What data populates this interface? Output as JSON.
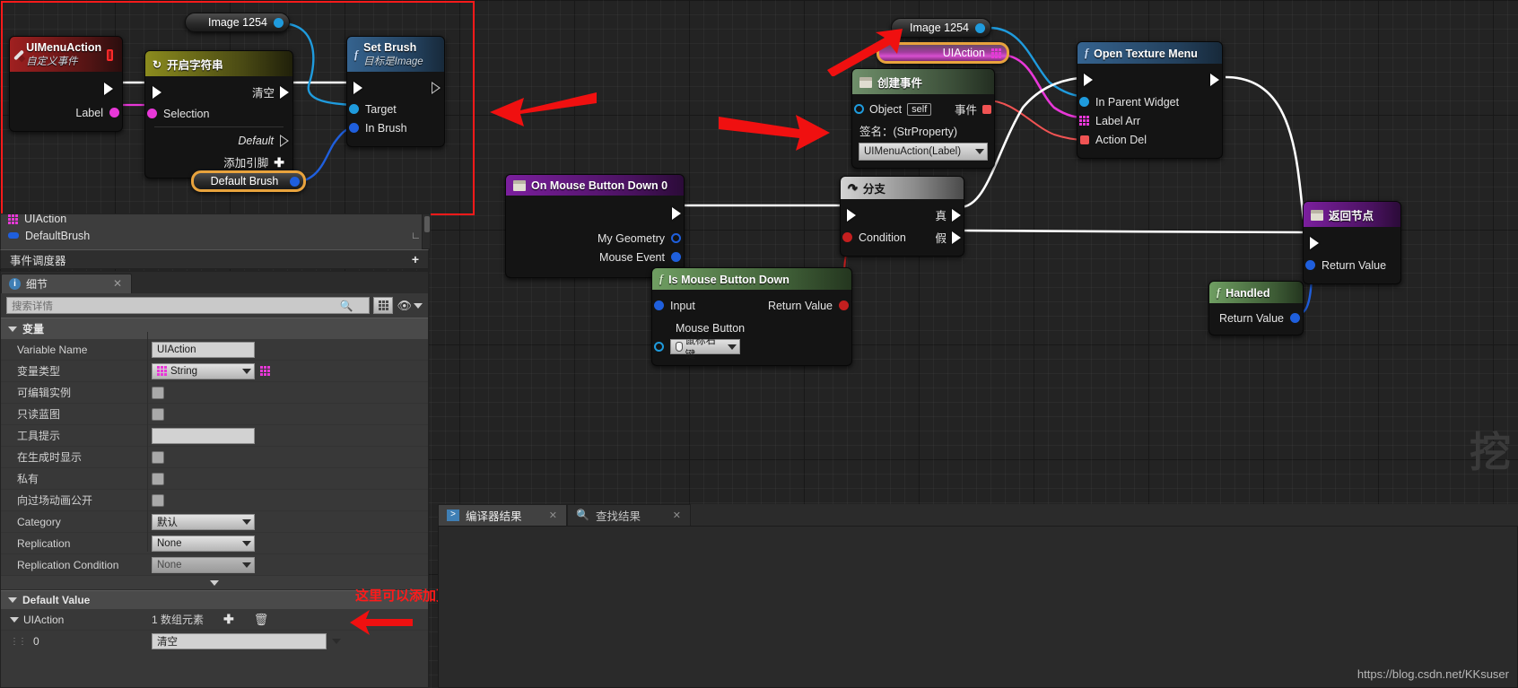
{
  "app": {
    "watermark": "https://blog.csdn.net/KKsuser"
  },
  "graph": {
    "nodes": {
      "image_get_left": {
        "label": "Image 1254"
      },
      "ui_menu_action": {
        "title": "UIMenuAction",
        "subtitle": "自定义事件",
        "out_exec": "",
        "pin_label": "Label"
      },
      "switch_string": {
        "title": "开启字符串",
        "out_clear": "清空",
        "in_selection": "Selection",
        "out_default": "Default",
        "add_pin": "添加引脚"
      },
      "set_brush": {
        "title": "Set Brush",
        "subtitle": "目标是Image",
        "pin_target": "Target",
        "pin_in_brush": "In Brush"
      },
      "default_brush": {
        "label": "Default Brush"
      },
      "image_get_right": {
        "label": "Image 1254"
      },
      "uiaction_get": {
        "label": "UIAction"
      },
      "create_event": {
        "title": "创建事件",
        "pin_object": "Object",
        "object_value": "self",
        "pin_event": "事件",
        "signature_label": "签名：(StrProperty)",
        "selected_signature": "UIMenuAction(Label)"
      },
      "open_texture_menu": {
        "title": "Open Texture Menu",
        "pin_in_parent_widget": "In Parent Widget",
        "pin_label_arr": "Label Arr",
        "pin_action_del": "Action Del"
      },
      "on_mouse_button_down": {
        "title": "On Mouse Button Down 0",
        "pin_my_geometry": "My Geometry",
        "pin_mouse_event": "Mouse Event"
      },
      "is_mouse_button_down": {
        "title": "Is Mouse Button Down",
        "pin_input": "Input",
        "pin_return_value": "Return Value",
        "pin_mouse_button": "Mouse Button",
        "mouse_button_value": "鼠标右键"
      },
      "branch": {
        "title": "分支",
        "pin_condition": "Condition",
        "pin_true": "真",
        "pin_false": "假"
      },
      "handled": {
        "title": "Handled",
        "pin_return_value": "Return Value"
      },
      "return_node": {
        "title": "返回节点",
        "pin_return_value": "Return Value"
      }
    }
  },
  "myblueprint": {
    "items": [
      {
        "label": "UIAction",
        "icon": "array-string-icon"
      },
      {
        "label": "DefaultBrush",
        "icon": "struct-icon"
      }
    ],
    "event_dispatcher_label": "事件调度器",
    "add_symbol": "+"
  },
  "details": {
    "tab_label": "细节",
    "tab_icon": "info-icon",
    "close_icon": "close-icon",
    "search_placeholder": "搜索详情",
    "search_icon": "search-icon",
    "grid_view_icon": "grid-view-icon",
    "eye_icon": "eye-icon",
    "section_variable": "变量",
    "rows": [
      {
        "name": "Variable Name",
        "type": "text",
        "value": "UIAction"
      },
      {
        "name": "变量类型",
        "type": "combo-type",
        "value": "String"
      },
      {
        "name": "可编辑实例",
        "type": "check",
        "value": ""
      },
      {
        "name": "只读蓝图",
        "type": "check",
        "value": ""
      },
      {
        "name": "工具提示",
        "type": "text",
        "value": ""
      },
      {
        "name": "在生成时显示",
        "type": "check",
        "value": ""
      },
      {
        "name": "私有",
        "type": "check",
        "value": ""
      },
      {
        "name": "向过场动画公开",
        "type": "check",
        "value": ""
      },
      {
        "name": "Category",
        "type": "combo",
        "value": "默认"
      },
      {
        "name": "Replication",
        "type": "combo",
        "value": "None"
      },
      {
        "name": "Replication Condition",
        "type": "combo-dim",
        "value": "None"
      }
    ],
    "section_default_value": "Default Value",
    "default_value": {
      "name": "UIAction",
      "array_count": "1 数组元素",
      "add_icon": "plus-icon",
      "delete_icon": "trash-icon",
      "elements": [
        {
          "index": "0",
          "value": "清空"
        }
      ]
    }
  },
  "bottom": {
    "tabs": [
      {
        "label": "编译器结果",
        "icon": "compiler-icon",
        "active": true,
        "closable": true
      },
      {
        "label": "查找结果",
        "icon": "search-icon",
        "active": false,
        "closable": true
      }
    ]
  },
  "annotations": {
    "note_add_more_menus": "这里可以添加更多菜单"
  },
  "colors": {
    "exec_white": "#ffffff",
    "string_magenta": "#e838d8",
    "object_blue": "#1f9bdd",
    "bool_red": "#c41f1f",
    "struct_blue": "#1f5fdd",
    "delegate_red": "#f05353",
    "selection_orange": "#e8a33d",
    "annotation_red": "#ff1a1a"
  }
}
